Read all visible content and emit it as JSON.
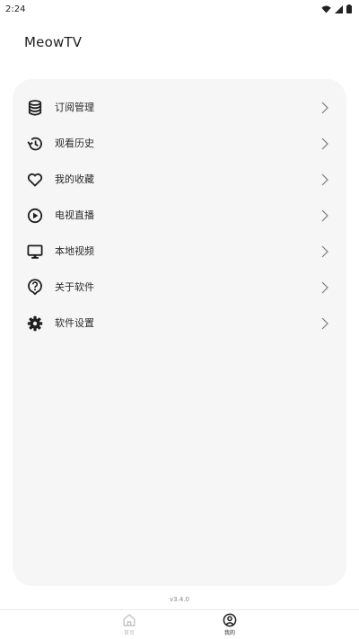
{
  "status_bar": {
    "time": "2:24"
  },
  "app": {
    "title": "MeowTV"
  },
  "menu": {
    "items": [
      {
        "label": "订阅管理",
        "icon": "database-icon"
      },
      {
        "label": "观看历史",
        "icon": "history-icon"
      },
      {
        "label": "我的收藏",
        "icon": "heart-icon"
      },
      {
        "label": "电视直播",
        "icon": "play-circle-icon"
      },
      {
        "label": "本地视频",
        "icon": "monitor-icon"
      },
      {
        "label": "关于软件",
        "icon": "help-circle-icon"
      },
      {
        "label": "软件设置",
        "icon": "gear-icon"
      }
    ]
  },
  "footer": {
    "version": "v3.4.0"
  },
  "bottom_nav": {
    "tabs": [
      {
        "label": "首页",
        "icon": "home-icon",
        "active": false
      },
      {
        "label": "我的",
        "icon": "account-circle-icon",
        "active": true
      }
    ]
  },
  "colors": {
    "card_bg": "#f6f6f6",
    "icon": "#1f1f1f",
    "inactive_tab": "#bdbdbd"
  }
}
